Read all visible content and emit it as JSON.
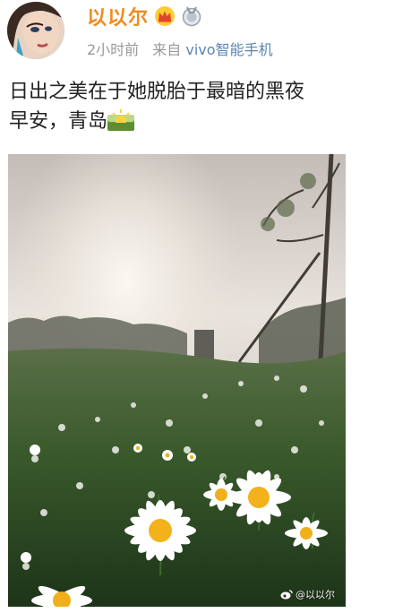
{
  "post": {
    "author": {
      "name": "以以尔",
      "avatar_icon": "avatar-portrait-icon",
      "badges": [
        "crown-vip-icon",
        "medal-badge-icon"
      ]
    },
    "meta": {
      "time": "2小时前",
      "from_label": "来自",
      "source": "vivo智能手机"
    },
    "text": {
      "line1": "日出之美在于她脱胎于最暗的黑夜",
      "line2": "早安，青岛",
      "emoji": "sunrise-emoji-icon"
    },
    "photo": {
      "subject": "daisy-field-sunrise-photo",
      "watermark": "@以以尔"
    }
  },
  "colors": {
    "username": "#f28a1d",
    "meta": "#999999",
    "source_link": "#5a86b4",
    "body_text": "#222222"
  }
}
